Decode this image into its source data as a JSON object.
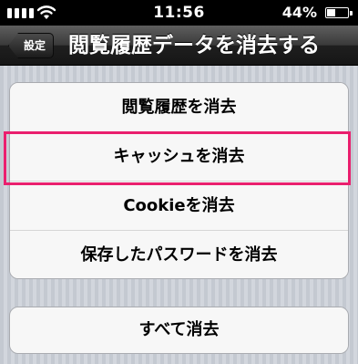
{
  "status_bar": {
    "time": "11:56",
    "battery_percent": "44%",
    "battery_level": 0.44,
    "icons": [
      "signal-icon",
      "wifi-icon",
      "battery-icon"
    ]
  },
  "nav": {
    "back_label": "設定",
    "title": "閲覧履歴データを消去する"
  },
  "group_main": {
    "items": [
      {
        "label": "閲覧履歴を消去"
      },
      {
        "label": "キャッシュを消去"
      },
      {
        "label": "Cookieを消去"
      },
      {
        "label": "保存したパスワードを消去"
      }
    ]
  },
  "group_all": {
    "label": "すべて消去"
  },
  "colors": {
    "highlight": "#ea1f6e",
    "navbar": "#3a3a3a",
    "background": "#c4c9d1"
  }
}
